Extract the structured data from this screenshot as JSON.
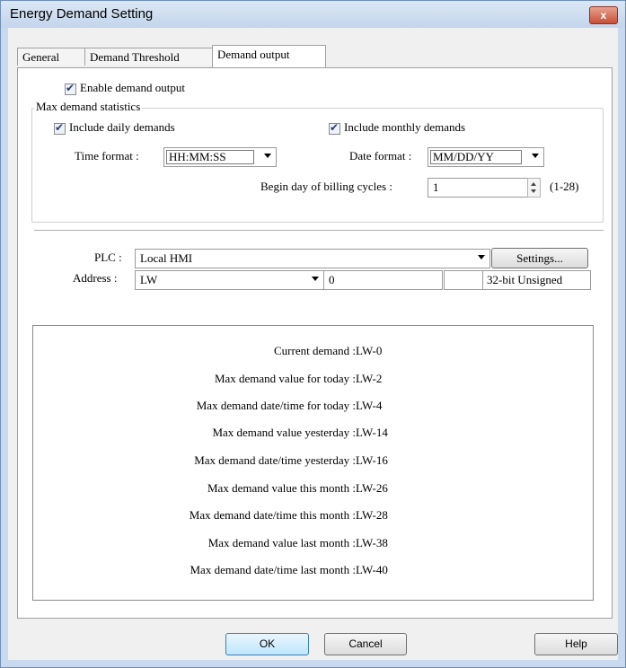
{
  "window": {
    "title": "Energy Demand Setting",
    "close_label": "x"
  },
  "tabs": [
    "General",
    "Demand Threshold",
    "Demand output"
  ],
  "enable_demand_output": {
    "label": "Enable demand output",
    "checked": true
  },
  "max_demand_statistics": {
    "group_label": "Max demand statistics",
    "include_daily": {
      "label": "Include daily demands",
      "checked": true
    },
    "include_monthly": {
      "label": "Include monthly demands",
      "checked": true
    },
    "time_format": {
      "label": "Time format :",
      "value": "HH:MM:SS"
    },
    "date_format": {
      "label": "Date format :",
      "value": "MM/DD/YY"
    },
    "begin_day": {
      "label": "Begin day of billing cycles :",
      "value": "1",
      "range": "(1-28)"
    }
  },
  "plc": {
    "label": "PLC :",
    "value": "Local HMI",
    "settings_button": "Settings..."
  },
  "address": {
    "label": "Address :",
    "device": "LW",
    "value": "0",
    "extra": "",
    "data_type": "32-bit Unsigned"
  },
  "address_list": [
    {
      "name": "Current demand :",
      "address": "LW-0"
    },
    {
      "name": "Max demand value for today :",
      "address": "LW-2"
    },
    {
      "name": "Max demand date/time for today :",
      "address": "LW-4"
    },
    {
      "name": "Max demand value yesterday :",
      "address": "LW-14"
    },
    {
      "name": "Max demand date/time yesterday :",
      "address": "LW-16"
    },
    {
      "name": "Max demand value this month :",
      "address": "LW-26"
    },
    {
      "name": "Max demand date/time this month :",
      "address": "LW-28"
    },
    {
      "name": "Max demand value last month :",
      "address": "LW-38"
    },
    {
      "name": "Max demand date/time last month :",
      "address": "LW-40"
    }
  ],
  "buttons": {
    "ok": "OK",
    "cancel": "Cancel",
    "help": "Help"
  }
}
